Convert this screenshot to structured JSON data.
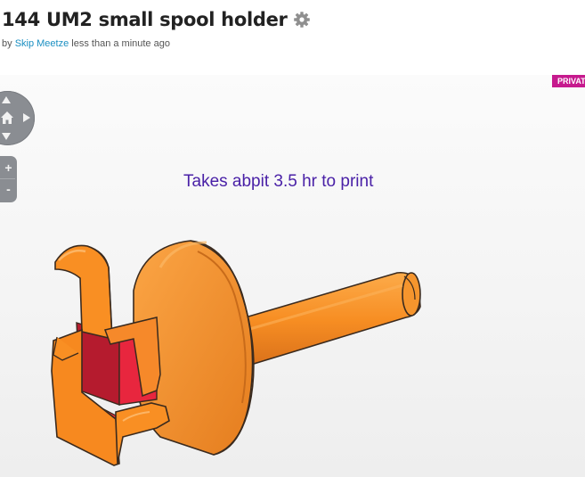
{
  "header": {
    "title": "144 UM2 small spool holder",
    "byline_prefix": "by",
    "author": "Skip Meetze",
    "timestamp": "less than a minute ago",
    "settings_icon": "gear-icon"
  },
  "viewer": {
    "badge": "PRIVATE",
    "annotation": "Takes abpit 3.5 hr to print",
    "nav": {
      "up_icon": "arrow-up-icon",
      "down_icon": "arrow-down-icon",
      "right_icon": "arrow-right-icon",
      "home_icon": "home-icon"
    },
    "zoom": {
      "in_label": "+",
      "out_label": "-"
    },
    "colors": {
      "model_orange": "#f98f23",
      "model_red": "#e8243d",
      "annotation": "#4a21a7",
      "badge": "#c61a8e",
      "controls": "#8a8d92"
    }
  }
}
